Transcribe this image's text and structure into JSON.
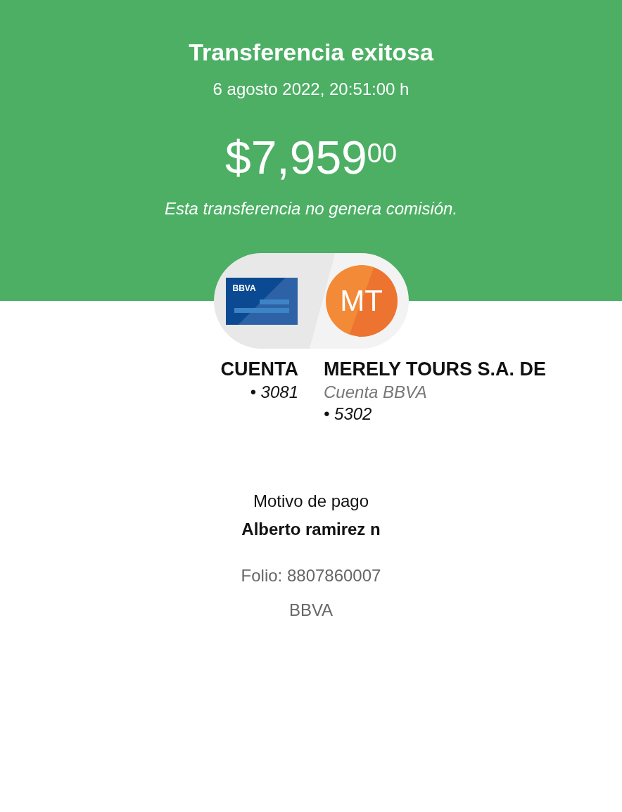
{
  "header": {
    "title": "Transferencia exitosa",
    "datetime": "6 agosto 2022, 20:51:00 h",
    "amount": "$7,959$^{00}$",
    "note": "Esta transferencia no genera comisión."
  },
  "origin": {
    "card_brand": "BBVA",
    "name": "CUENTA",
    "lines": [
      "• 3081"
    ]
  },
  "destination": {
    "initials": "MT",
    "name": "MERELY TOURS S.A. DE",
    "bank": "Cuenta BBVA",
    "lines": [
      "• 5302"
    ]
  },
  "details": {
    "label": "Motivo de pago",
    "value": "Alberto ramirez n",
    "folio": "Folio: 8807860007",
    "bank": "BBVA"
  }
}
